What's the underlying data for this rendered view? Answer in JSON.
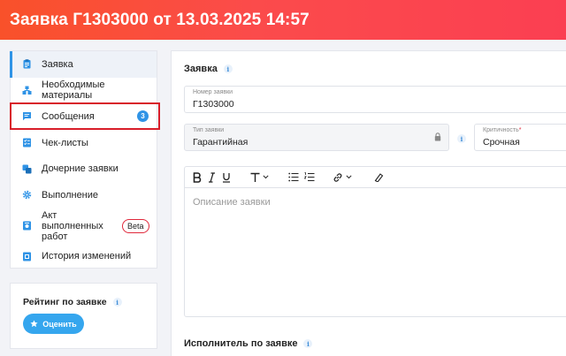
{
  "header": {
    "title": "Заявка Г1303000 от 13.03.2025 14:57"
  },
  "sidebar": {
    "items": [
      {
        "label": "Заявка",
        "icon": "document-icon"
      },
      {
        "label": "Необходимые материалы",
        "icon": "blocks-icon"
      },
      {
        "label": "Сообщения",
        "icon": "chat-icon",
        "badge": "3"
      },
      {
        "label": "Чек-листы",
        "icon": "checklist-icon"
      },
      {
        "label": "Дочерние заявки",
        "icon": "copy-icon"
      },
      {
        "label": "Выполнение",
        "icon": "gear-icon"
      },
      {
        "label": "Акт выполненных работ",
        "icon": "act-icon",
        "tag": "Beta"
      },
      {
        "label": "История изменений",
        "icon": "history-icon"
      }
    ],
    "active_index": 0,
    "accent": "#2f93e6"
  },
  "rating": {
    "title": "Рейтинг по заявке",
    "button": "Оценить"
  },
  "main": {
    "section_title": "Заявка",
    "number_field": {
      "label": "Номер заявки",
      "value": "Г1303000"
    },
    "type_field": {
      "label": "Тип заявки",
      "value": "Гарантийная"
    },
    "criticality_field": {
      "label": "Критичность",
      "value": "Срочная"
    },
    "editor": {
      "placeholder": "Описание заявки"
    },
    "executor_title": "Исполнитель по заявке"
  },
  "colors": {
    "header_start": "#f9512a",
    "header_end": "#fb3f52",
    "highlight": "#d81e2a"
  }
}
